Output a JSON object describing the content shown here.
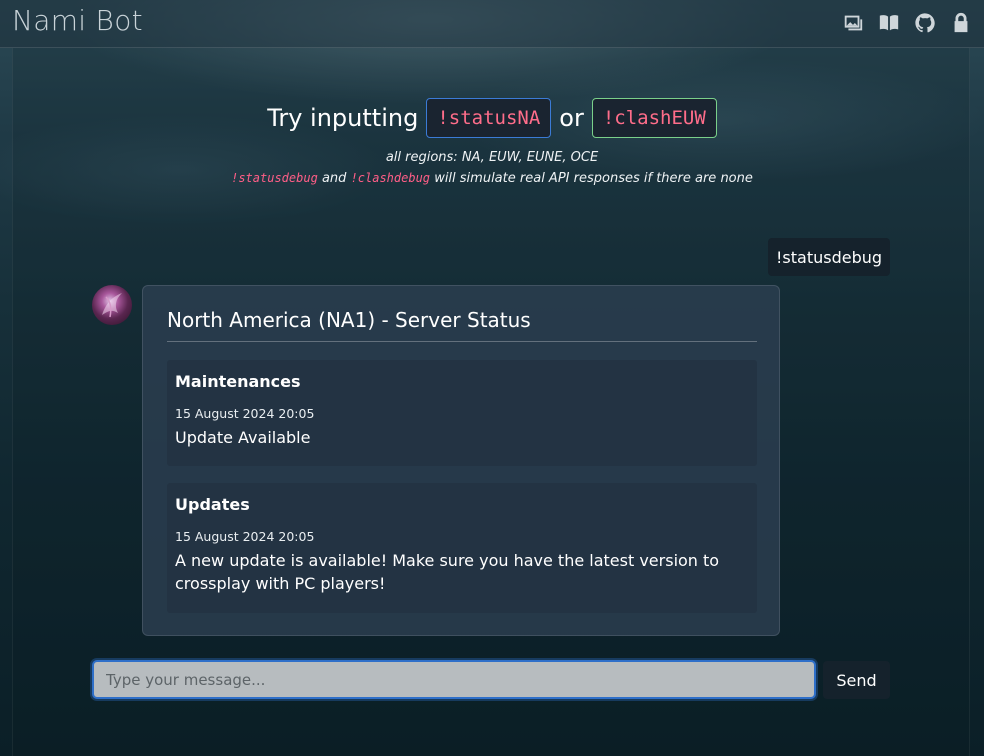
{
  "header": {
    "brand": "Nami Bot",
    "icons": [
      "gallery-icon",
      "book-icon",
      "github-icon",
      "lock-icon"
    ]
  },
  "intro": {
    "try_prefix": "Try inputting",
    "cmd_status": "!statusNA",
    "or_word": "or",
    "cmd_clash": "!clashEUW",
    "regions": "all regions: NA, EUW, EUNE, OCE",
    "debug_cmd1": "!statusdebug",
    "and_word": "and",
    "debug_cmd2": "!clashdebug",
    "debug_suffix": "will simulate real API responses if there are none"
  },
  "conversation": {
    "user_message": "!statusdebug",
    "bot_card": {
      "title": "North America (NA1) - Server Status",
      "sections": [
        {
          "heading": "Maintenances",
          "date": "15 August 2024 20:05",
          "text": "Update Available"
        },
        {
          "heading": "Updates",
          "date": "15 August 2024 20:05",
          "text": "A new update is available! Make sure you have the latest version to crossplay with PC players!"
        }
      ]
    }
  },
  "composer": {
    "placeholder": "Type your message...",
    "send_label": "Send"
  },
  "colors": {
    "command_pink": "#ff6d8a",
    "blue_border": "#3b7bd6",
    "green_border": "#7ad08a",
    "card_bg": "#2c3e50"
  }
}
